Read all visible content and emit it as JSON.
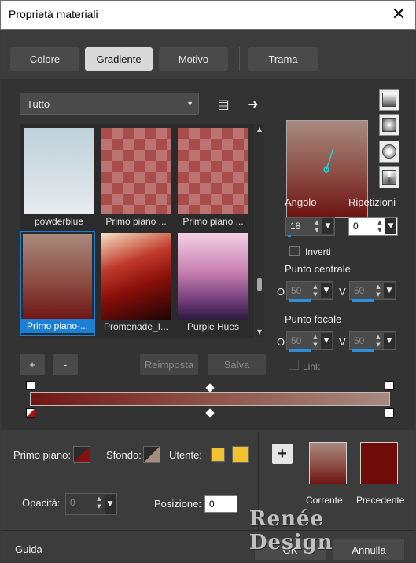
{
  "window": {
    "title": "Proprietà materiali",
    "close_glyph": "✕"
  },
  "tabs": [
    {
      "label": "Colore"
    },
    {
      "label": "Gradiente"
    },
    {
      "label": "Motivo"
    },
    {
      "label": "Trama"
    }
  ],
  "category": {
    "value": "Tutto",
    "chevron": "▼"
  },
  "icons": {
    "library_icon": "▤",
    "arrow_icon": "➜"
  },
  "swatches": [
    {
      "label": "powderblue",
      "style": "linear-gradient(180deg,#bcd2da,#d6dfe4 60%,#e8edf0)"
    },
    {
      "label": "Primo piano ...",
      "style": "checker-dark"
    },
    {
      "label": "Primo piano ...",
      "style": "checker-dark"
    },
    {
      "label": "Primo piano-...",
      "style": "linear-gradient(180deg,#a88a7e,#8c4d44 55%,#6f1514)"
    },
    {
      "label": "Promenade_I...",
      "style": "linear-gradient(160deg,#f4e3c4 0%,#c0392b 35%,#8b0f0a 60%,#1a0505 100%)"
    },
    {
      "label": "Purple Hues",
      "style": "linear-gradient(180deg,#f2d0e4,#c77fae 45%,#6b3a77 80%,#2c1a3c)"
    }
  ],
  "selected_swatch": "Primo piano-...",
  "buttons": {
    "add": "+",
    "remove": "-",
    "reset": "Reimposta",
    "save": "Salva",
    "ok": "OK",
    "cancel": "Annulla",
    "help": "Guida"
  },
  "angle": {
    "label": "Angolo",
    "value": "18"
  },
  "repeats": {
    "label": "Ripetizioni",
    "value": "0"
  },
  "invert": {
    "label": "Inverti",
    "checked": false
  },
  "center_point": {
    "label": "Punto centrale",
    "h_label": "O",
    "v_label": "V",
    "h_value": "50",
    "v_value": "50"
  },
  "focal_point": {
    "label": "Punto focale",
    "h_label": "O",
    "v_label": "V",
    "h_value": "50",
    "v_value": "50"
  },
  "link": {
    "label": "Link",
    "checked": false
  },
  "gradient": {
    "start_color": "#6f1514",
    "mid_color": "#8c4d44",
    "end_color": "#a88a7e"
  },
  "foreground": {
    "label": "Primo piano:",
    "color": "#6f1514"
  },
  "background": {
    "label": "Sfondo:",
    "color": "#a88a7e"
  },
  "user": {
    "label": "Utente:",
    "color1": "#f2c12e",
    "color2": "#f2c12e",
    "add_glyph": "+"
  },
  "opacity": {
    "label": "Opacità:",
    "value": "0"
  },
  "position": {
    "label": "Posizione:",
    "value": "0"
  },
  "current": {
    "label": "Corrente"
  },
  "previous": {
    "label": "Precedente",
    "color": "#6f0c0a"
  },
  "watermark": "Renée Design"
}
